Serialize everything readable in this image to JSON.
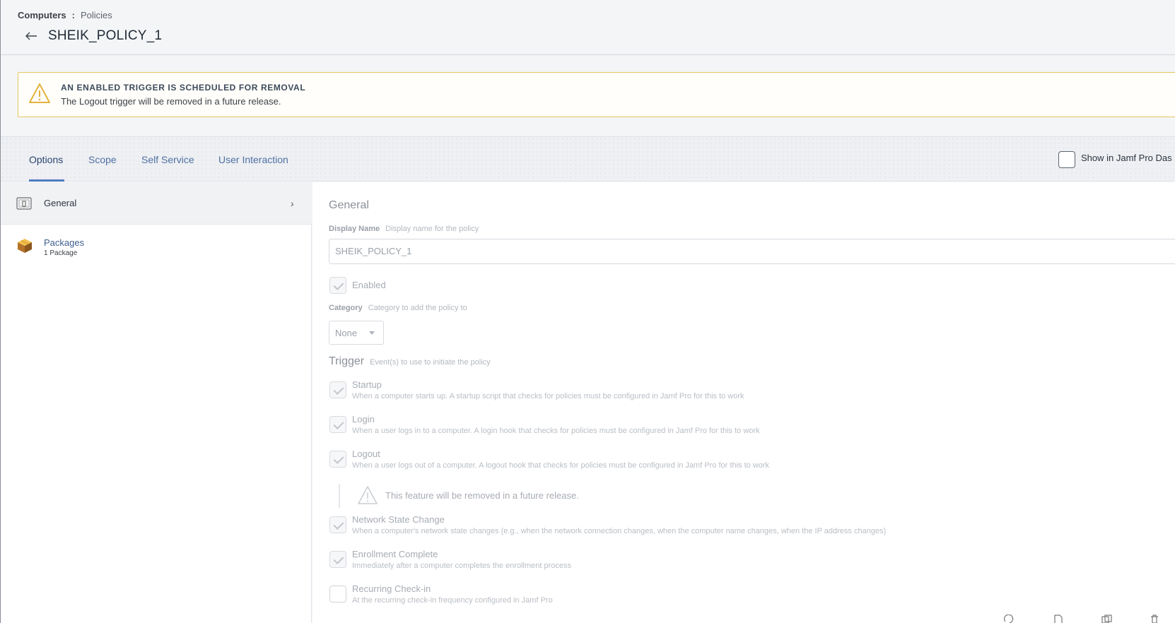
{
  "breadcrumb": {
    "section": "Computers",
    "separator": ":",
    "page": "Policies"
  },
  "page_title": "SHEIK_POLICY_1",
  "banner": {
    "title": "AN ENABLED TRIGGER IS SCHEDULED FOR REMOVAL",
    "text": "The Logout trigger will be removed in a future release.",
    "icon": "warning-triangle-icon",
    "border_color": "#e4c75a"
  },
  "tabs": [
    {
      "label": "Options",
      "active": true
    },
    {
      "label": "Scope"
    },
    {
      "label": "Self Service"
    },
    {
      "label": "User Interaction"
    }
  ],
  "dashboard_checkbox": {
    "label": "Show in Jamf Pro Das",
    "checked": false
  },
  "sidebar": {
    "items": [
      {
        "label": "General",
        "icon": "general-switch-icon",
        "active": true
      },
      {
        "label": "Packages",
        "sublabel": "1 Package",
        "icon": "package-box-icon"
      }
    ]
  },
  "general": {
    "title": "General",
    "display_name": {
      "label": "Display Name",
      "hint": "Display name for the policy",
      "value": "SHEIK_POLICY_1"
    },
    "enabled": {
      "label": "Enabled",
      "checked": true
    },
    "category": {
      "label": "Category",
      "hint": "Category to add the policy to",
      "value": "None"
    },
    "trigger": {
      "title": "Trigger",
      "hint": "Event(s) to use to initiate the policy",
      "options": [
        {
          "label": "Startup",
          "desc": "When a computer starts up. A startup script that checks for policies must be configured in Jamf Pro for this to work",
          "checked": true
        },
        {
          "label": "Login",
          "desc": "When a user logs in to a computer. A login hook that checks for policies must be configured in Jamf Pro for this to work",
          "checked": true
        },
        {
          "label": "Logout",
          "desc": "When a user logs out of a computer. A logout hook that checks for policies must be configured in Jamf Pro for this to work",
          "checked": true
        },
        {
          "label": "Network State Change",
          "desc": "When a computer's network state changes (e.g., when the network connection changes, when the computer name changes, when the IP address changes)",
          "checked": true
        },
        {
          "label": "Enrollment Complete",
          "desc": "Immediately after a computer completes the enrollment process",
          "checked": true
        },
        {
          "label": "Recurring Check-in",
          "desc": "At the recurring check-in frequency configured in Jamf Pro",
          "checked": false
        }
      ],
      "logout_note": "This feature will be removed in a future release."
    }
  }
}
